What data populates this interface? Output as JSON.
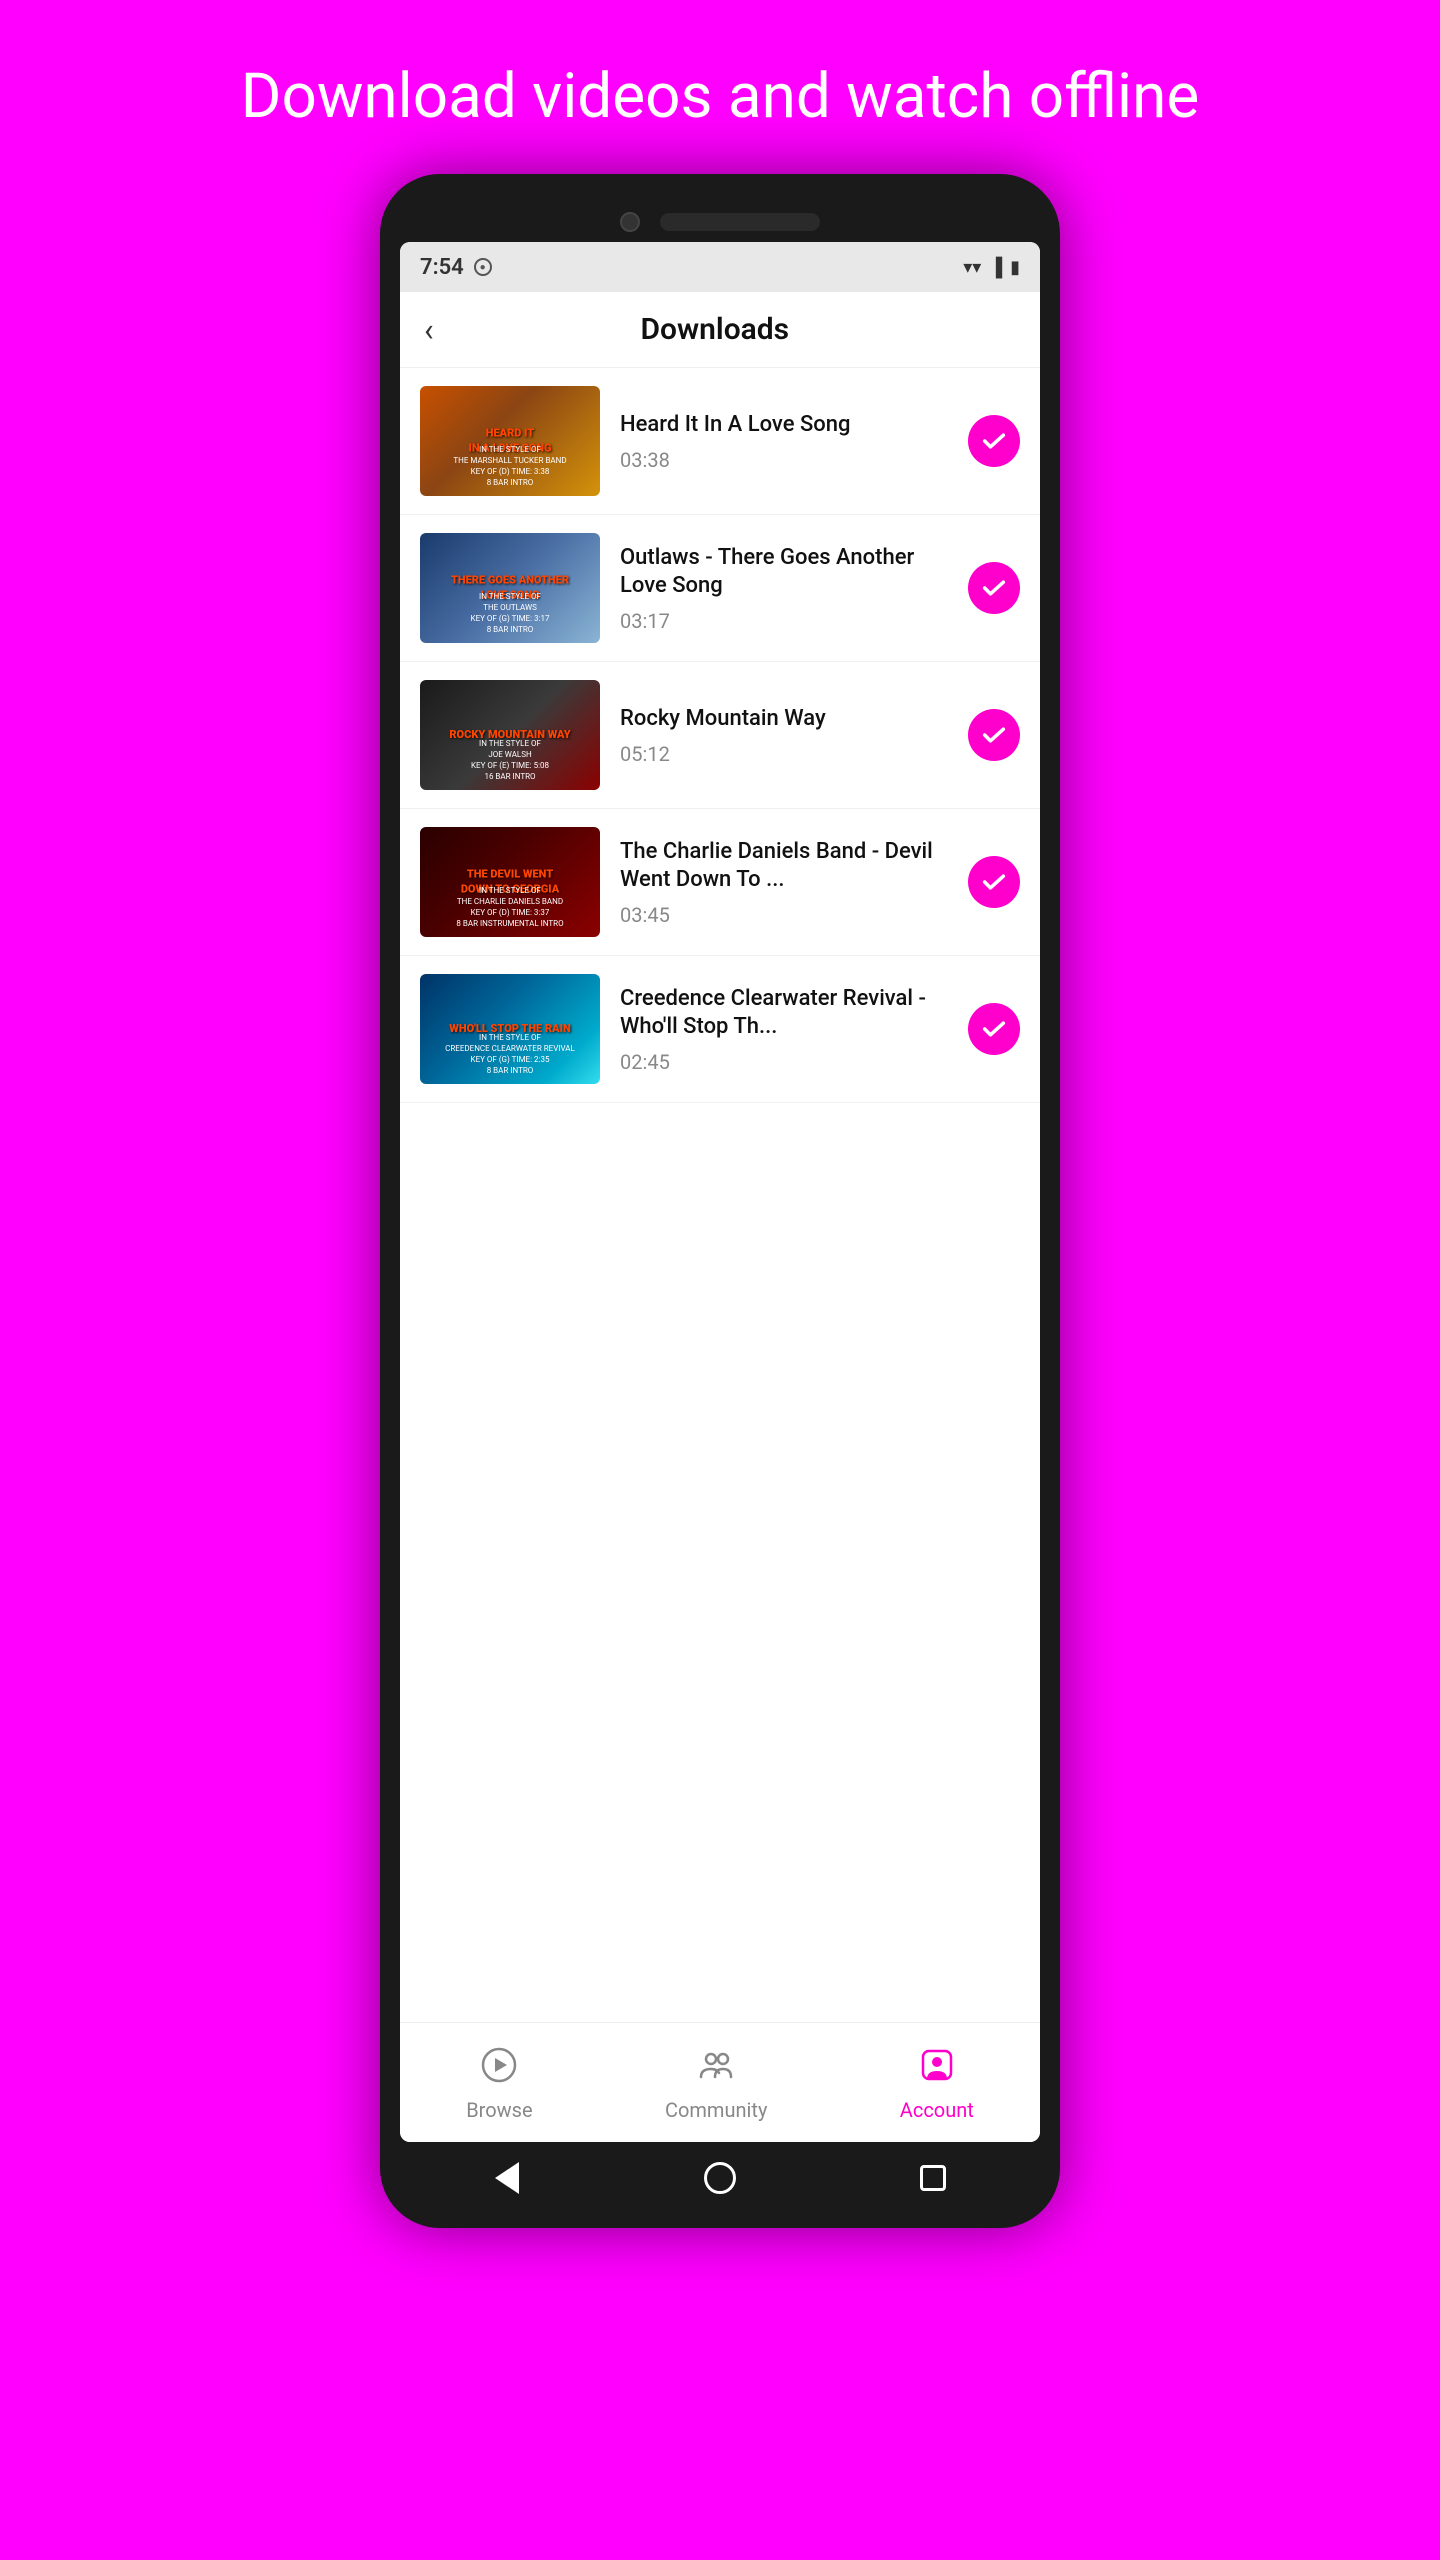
{
  "page": {
    "background_header": "Download videos and watch offline",
    "title": "Downloads"
  },
  "status_bar": {
    "time": "7:54",
    "wifi_icon": "wifi",
    "signal_icon": "signal",
    "battery_icon": "battery"
  },
  "downloads": [
    {
      "id": 1,
      "title": "Heard It In A Love Song",
      "duration": "03:38",
      "thumb_class": "thumb-1",
      "thumb_text": "HEARD IT IN A LOVE SONG",
      "thumb_sub": "IN THE STYLE OF\nTHE MARSHALL TUCKER BAND\nKEY OF (D)  TIME: 3:38\n8 BAR INTRO",
      "downloaded": true
    },
    {
      "id": 2,
      "title": "Outlaws - There Goes Another Love Song",
      "duration": "03:17",
      "thumb_class": "thumb-2",
      "thumb_text": "THERE GOES ANOTHER LOVE SONG",
      "thumb_sub": "IN THE STYLE OF\nTHE OUTLAWS\nKEY OF (G)  TIME: 3:17\n8 BAR INTRO",
      "downloaded": true
    },
    {
      "id": 3,
      "title": "Rocky Mountain Way",
      "duration": "05:12",
      "thumb_class": "thumb-3",
      "thumb_text": "ROCKY MOUNTAIN WAY",
      "thumb_sub": "IN THE STYLE OF\nJOE WALSH\nKEY OF (E)  TIME: 5:08\n16 BAR INTRO",
      "downloaded": true
    },
    {
      "id": 4,
      "title": "The Charlie Daniels Band - Devil Went Down To ...",
      "duration": "03:45",
      "thumb_class": "thumb-4",
      "thumb_text": "THE DEVIL WENT DOWN TO GEORGIA",
      "thumb_sub": "IN THE STYLE OF\nTHE CHARLIE DANIELS BAND\nKEY OF (D)  TIME: 3:37\n8 BAR INSTRUMENTAL INTRO",
      "downloaded": true
    },
    {
      "id": 5,
      "title": "Creedence Clearwater Revival - Who'll Stop Th...",
      "duration": "02:45",
      "thumb_class": "thumb-5",
      "thumb_text": "WHO'LL STOP THE RAIN",
      "thumb_sub": "IN THE STYLE OF\nCREEDENCE CLEARWATER REVIVAL\nKEY OF (G)  TIME: 2:35\n8 BAR INTRO",
      "downloaded": true
    }
  ],
  "bottom_nav": {
    "items": [
      {
        "id": "browse",
        "label": "Browse",
        "active": false
      },
      {
        "id": "community",
        "label": "Community",
        "active": false
      },
      {
        "id": "account",
        "label": "Account",
        "active": true
      }
    ]
  }
}
